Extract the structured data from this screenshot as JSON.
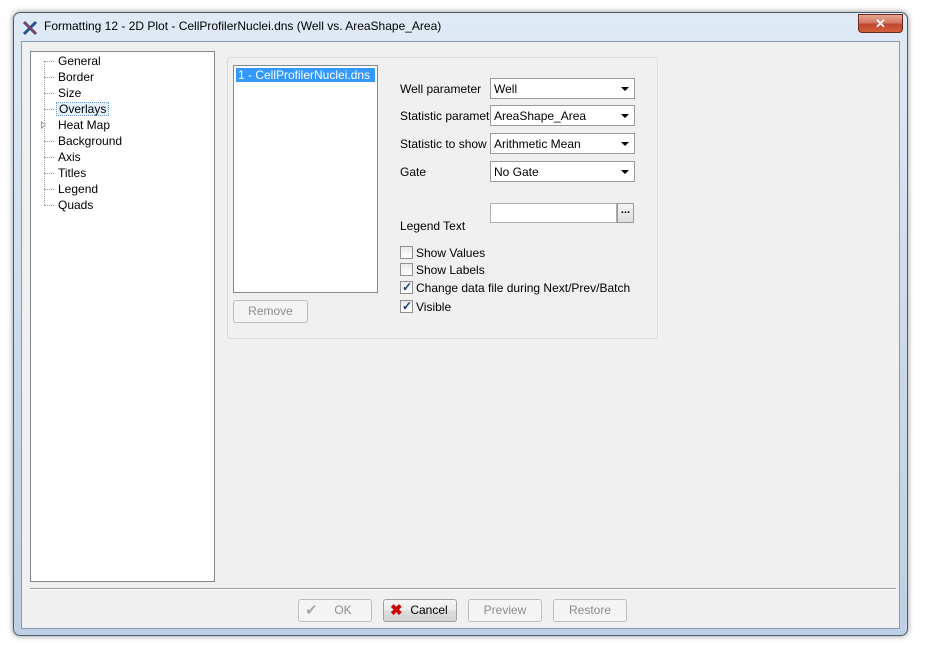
{
  "window": {
    "title": "Formatting 12 - 2D Plot - CellProfilerNuclei.dns (Well vs. AreaShape_Area)",
    "close_label": "✕"
  },
  "tree": {
    "items": [
      {
        "label": "General"
      },
      {
        "label": "Border"
      },
      {
        "label": "Size"
      },
      {
        "label": "Overlays",
        "selected": true
      },
      {
        "label": "Heat Map",
        "expandable": true
      },
      {
        "label": "Background"
      },
      {
        "label": "Axis"
      },
      {
        "label": "Titles"
      },
      {
        "label": "Legend"
      },
      {
        "label": "Quads"
      }
    ]
  },
  "overlays": {
    "list_items": [
      "1 - CellProfilerNuclei.dns"
    ],
    "remove_label": "Remove",
    "fields": {
      "well_parameter": {
        "label": "Well parameter",
        "value": "Well"
      },
      "statistic_parameter": {
        "label": "Statistic parameter",
        "value": "AreaShape_Area"
      },
      "statistic_to_show": {
        "label": "Statistic to show",
        "value": "Arithmetic Mean"
      },
      "gate": {
        "label": "Gate",
        "value": "No Gate"
      }
    },
    "legend_text": {
      "label": "Legend Text",
      "value": "",
      "button": "..."
    },
    "checkboxes": {
      "show_values": {
        "label": "Show Values",
        "checked": false
      },
      "show_labels": {
        "label": "Show Labels",
        "checked": false
      },
      "change_data_file": {
        "label": "Change data file during Next/Prev/Batch",
        "checked": true
      },
      "visible": {
        "label": "Visible",
        "checked": true
      }
    }
  },
  "footer": {
    "ok_label": "OK",
    "cancel_label": "Cancel",
    "preview_label": "Preview",
    "restore_label": "Restore"
  },
  "colors": {
    "selection": "#3399ff",
    "cancel_icon": "#cc0000"
  }
}
